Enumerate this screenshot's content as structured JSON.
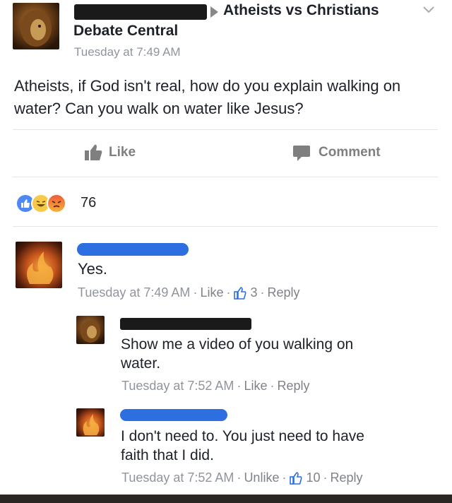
{
  "post": {
    "group_name": "Atheists vs Christians",
    "group_line2": "Debate Central",
    "timestamp": "Tuesday at 7:49 AM",
    "body": "Atheists, if God isn't real, how do you explain walking on water? Can you walk on water like Jesus?",
    "like_label": "Like",
    "comment_label": "Comment",
    "reaction_count": "76",
    "reaction_icons": [
      "like-icon",
      "haha-icon",
      "angry-icon"
    ],
    "colors": {
      "like_blue": "#4f87f5",
      "haha_yellow": "#f7c948",
      "angry_red": "#ef5b3a",
      "redact_blue": "#2d6fe0"
    }
  },
  "comments": [
    {
      "text": "Yes.",
      "timestamp": "Tuesday at 7:49 AM",
      "action": "Like",
      "like_count": "3",
      "reply": "Reply"
    },
    {
      "text_line1": "Show me a video of you walking on",
      "text_line2": "water.",
      "timestamp": "Tuesday at 7:52 AM",
      "action": "Like",
      "reply": "Reply"
    },
    {
      "text_line1": "I don't need to. You just need to have",
      "text_line2": "faith that I did.",
      "timestamp": "Tuesday at 7:52 AM",
      "action": "Unlike",
      "like_count": "10",
      "reply": "Reply"
    }
  ]
}
